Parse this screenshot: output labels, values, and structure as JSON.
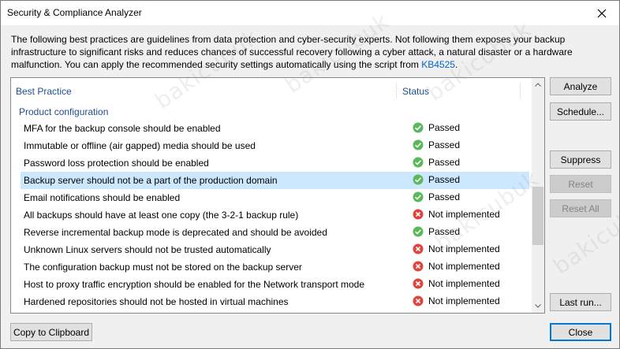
{
  "window": {
    "title": "Security & Compliance Analyzer"
  },
  "description": {
    "text": "The following best practices are guidelines from data protection and cyber-security experts. Not following them exposes your backup infrastructure to significant risks and reduces chances of successful recovery following a cyber attack, a natural disaster or a hardware malfunction. You can apply the recommended security settings automatically using the script from ",
    "link_text": "KB4525",
    "suffix": "."
  },
  "table": {
    "columns": {
      "practice": "Best Practice",
      "status": "Status"
    },
    "group_label": "Product configuration",
    "rows": [
      {
        "practice": "MFA for the backup console should be enabled",
        "status": "Passed",
        "state": "passed"
      },
      {
        "practice": "Immutable or offline (air gapped) media should be used",
        "status": "Passed",
        "state": "passed"
      },
      {
        "practice": "Password loss protection should be enabled",
        "status": "Passed",
        "state": "passed"
      },
      {
        "practice": "Backup server should not be a part of the production domain",
        "status": "Passed",
        "state": "passed",
        "selected": true
      },
      {
        "practice": "Email notifications should be enabled",
        "status": "Passed",
        "state": "passed"
      },
      {
        "practice": "All backups should have at least one copy (the 3-2-1 backup rule)",
        "status": "Not implemented",
        "state": "failed"
      },
      {
        "practice": "Reverse incremental backup mode is deprecated and should be avoided",
        "status": "Passed",
        "state": "passed"
      },
      {
        "practice": "Unknown Linux servers should not be trusted automatically",
        "status": "Not implemented",
        "state": "failed"
      },
      {
        "practice": "The configuration backup must not be stored on the backup server",
        "status": "Not implemented",
        "state": "failed"
      },
      {
        "practice": "Host to proxy traffic encryption should be enabled for the Network transport mode",
        "status": "Not implemented",
        "state": "failed"
      },
      {
        "practice": "Hardened repositories should not be hosted in virtual machines",
        "status": "Not implemented",
        "state": "failed"
      }
    ]
  },
  "buttons": {
    "analyze": "Analyze",
    "schedule": "Schedule...",
    "suppress": "Suppress",
    "reset": "Reset",
    "reset_all": "Reset All",
    "last_run": "Last run...",
    "close": "Close",
    "copy": "Copy to Clipboard"
  },
  "watermark": "bakicubuk",
  "colors": {
    "passed": "#5cb85c",
    "failed": "#e0443c",
    "header_text": "#1f4e8c",
    "selection": "#cce8ff",
    "link": "#0066cc"
  },
  "icons": {
    "close": "close-icon",
    "passed": "check-circle-icon",
    "failed": "x-circle-icon",
    "scroll_up": "chevron-up-icon",
    "scroll_down": "chevron-down-icon"
  }
}
